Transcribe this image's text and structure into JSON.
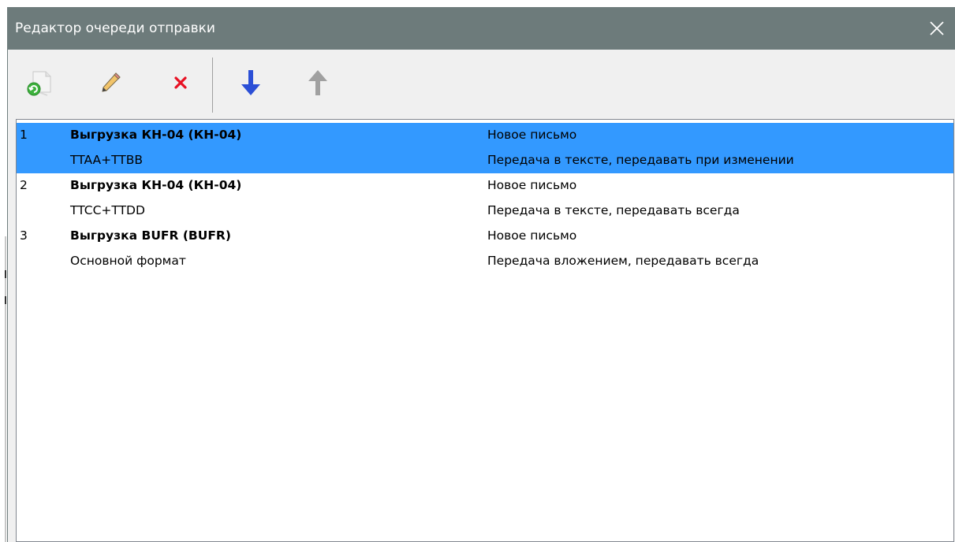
{
  "window": {
    "title": "Редактор очереди отправки",
    "close_icon": "close-icon"
  },
  "toolbar": {
    "buttons": [
      {
        "name": "add",
        "icon": "add-document-icon",
        "enabled": true
      },
      {
        "name": "edit",
        "icon": "pencil-icon",
        "enabled": true
      },
      {
        "name": "delete",
        "icon": "red-cross-icon",
        "enabled": true
      },
      {
        "name": "move-down",
        "icon": "arrow-down-icon",
        "enabled": true
      },
      {
        "name": "move-up",
        "icon": "arrow-up-icon",
        "enabled": false
      }
    ]
  },
  "queue": {
    "selected_index": 0,
    "items": [
      {
        "num": "1",
        "name": "Выгрузка КН-04 (КН-04)",
        "format": "TTAA+TTBB",
        "type": "Новое письмо",
        "mode": "Передача в тексте, передавать при изменении"
      },
      {
        "num": "2",
        "name": "Выгрузка КН-04 (КН-04)",
        "format": "TTCC+TTDD",
        "type": "Новое письмо",
        "mode": "Передача в тексте, передавать всегда"
      },
      {
        "num": "3",
        "name": "Выгрузка BUFR (BUFR)",
        "format": "Основной формат",
        "type": "Новое письмо",
        "mode": "Передача вложением, передавать всегда"
      }
    ]
  },
  "colors": {
    "titlebar": "#6d7b7b",
    "selection": "#3399ff",
    "delete": "#e81123",
    "arrow_down": "#2b4fd6",
    "arrow_up_disabled": "#a0a0a0"
  }
}
